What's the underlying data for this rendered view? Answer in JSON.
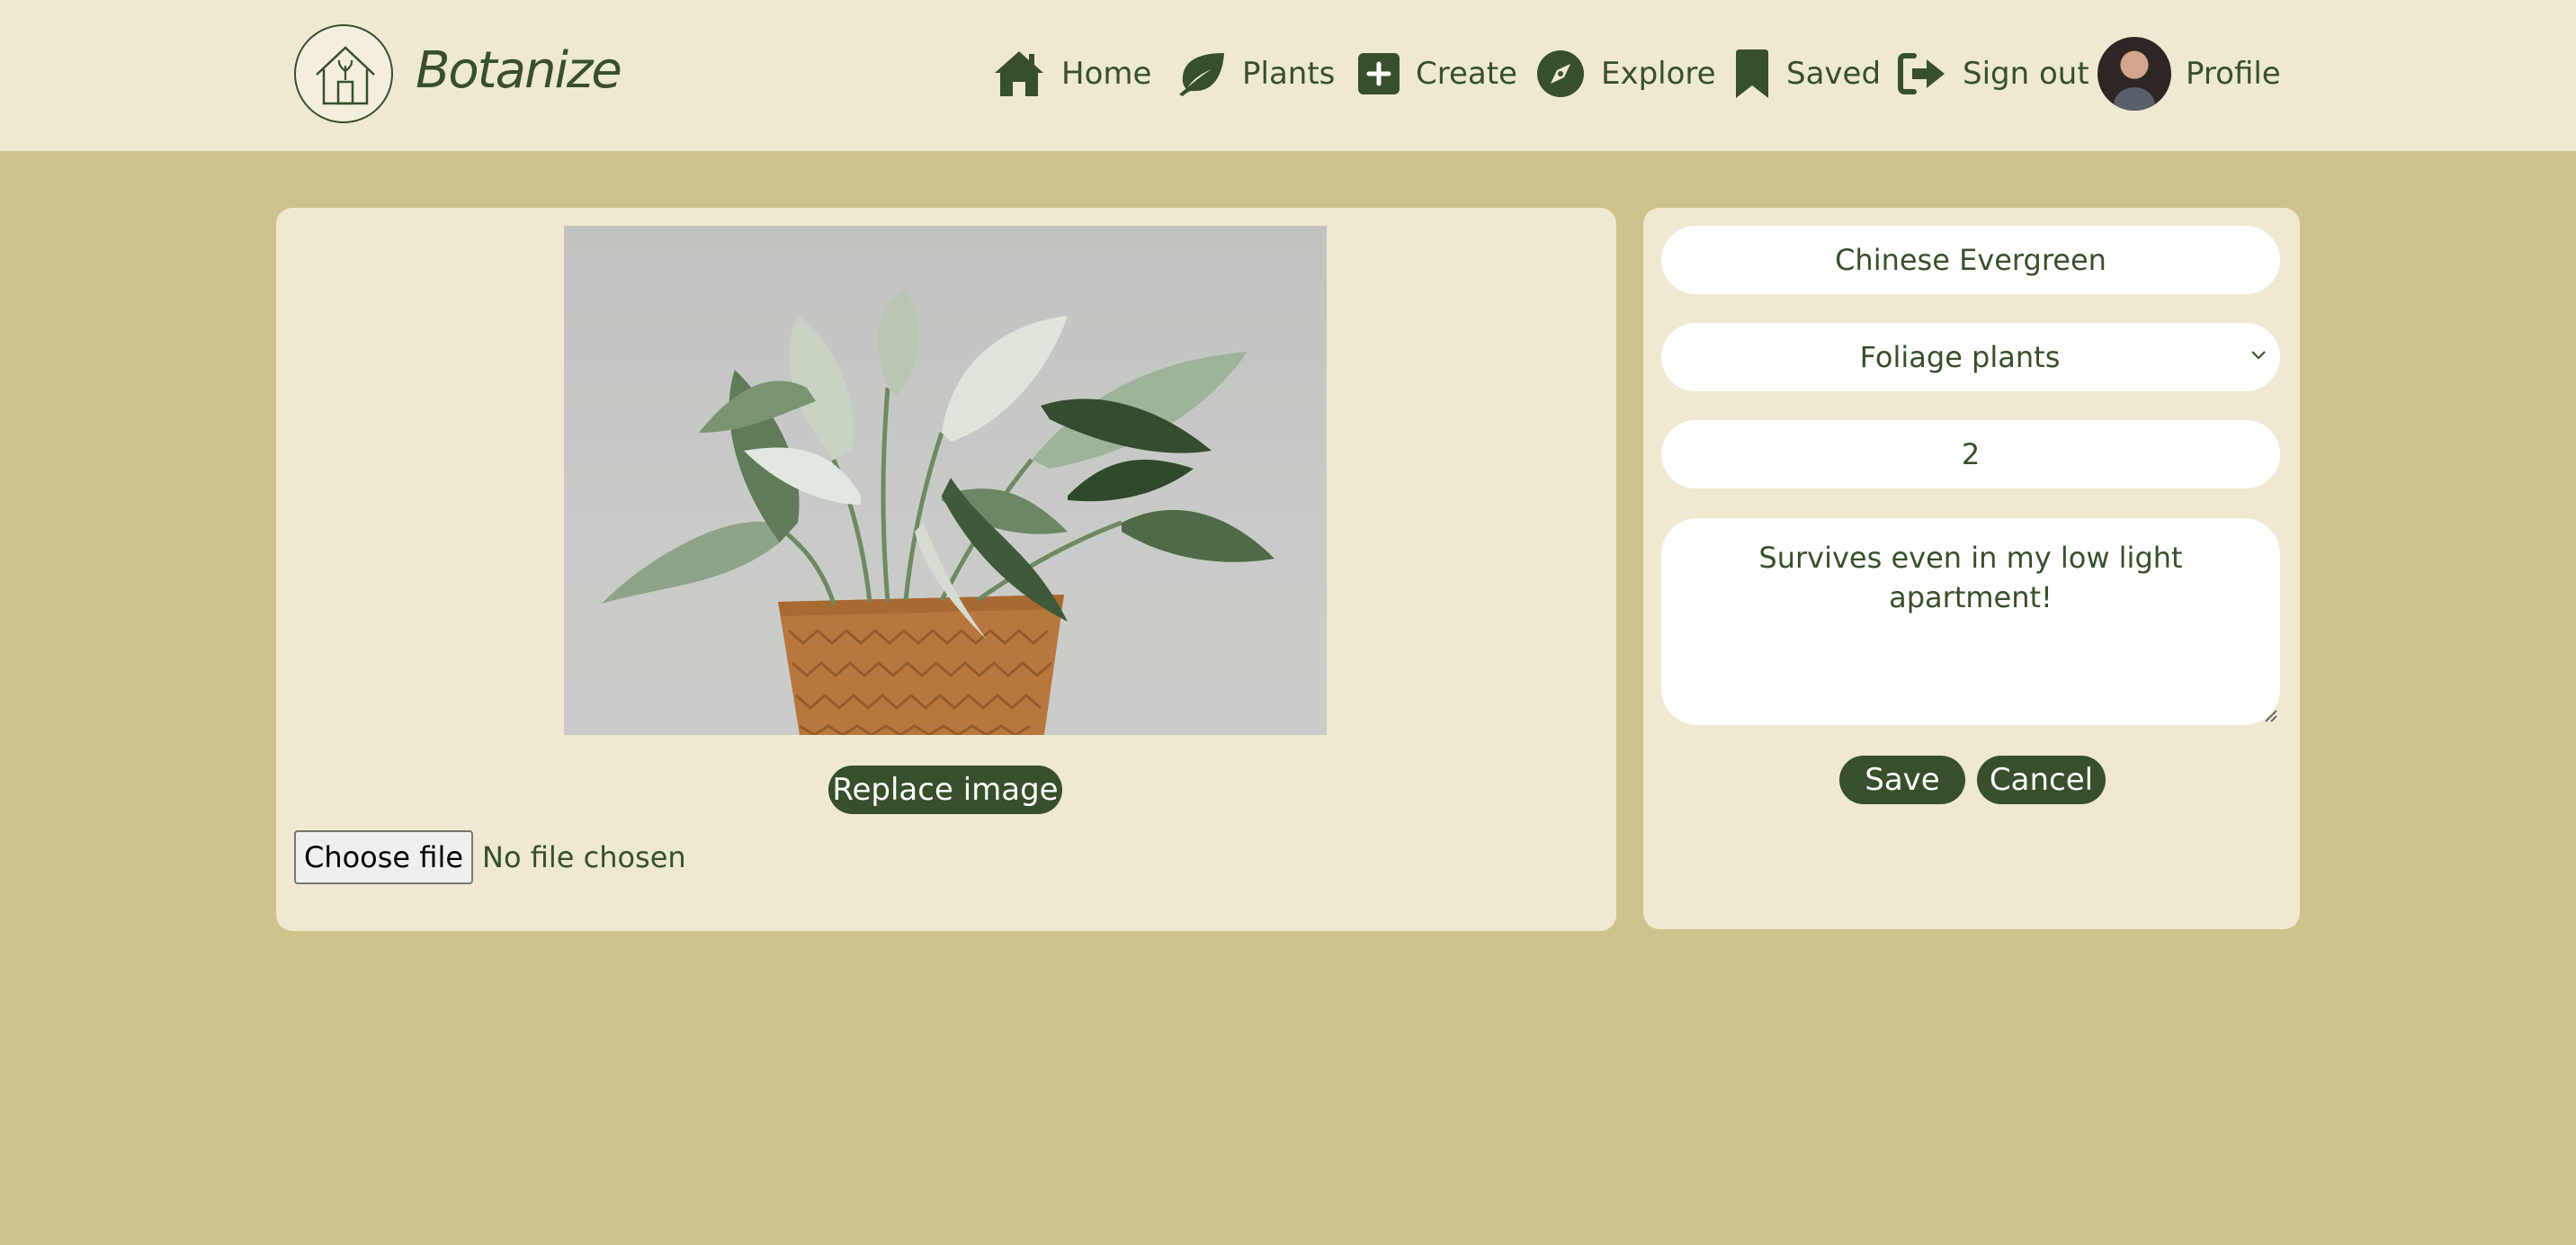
{
  "app": {
    "brand": "Botanize"
  },
  "nav": {
    "items": [
      {
        "label": "Home",
        "icon": "home-icon"
      },
      {
        "label": "Plants",
        "icon": "leaf-icon"
      },
      {
        "label": "Create",
        "icon": "plus-square-icon"
      },
      {
        "label": "Explore",
        "icon": "compass-icon"
      },
      {
        "label": "Saved",
        "icon": "bookmark-icon"
      },
      {
        "label": "Sign out",
        "icon": "sign-out-icon"
      },
      {
        "label": "Profile",
        "icon": "avatar"
      }
    ]
  },
  "image_panel": {
    "replace_label": "Replace image",
    "choose_file_label": "Choose file",
    "file_status": "No file chosen"
  },
  "form": {
    "name_value": "Chinese Evergreen",
    "category_value": "Foliage plants",
    "quantity_value": "2",
    "notes_value": "Survives even in my low light apartment!",
    "save_label": "Save",
    "cancel_label": "Cancel"
  },
  "colors": {
    "page_background": "#cfc38c",
    "panel_background": "#eee9d0",
    "accent_dark_green": "#37502b",
    "input_background": "#ffffff"
  }
}
